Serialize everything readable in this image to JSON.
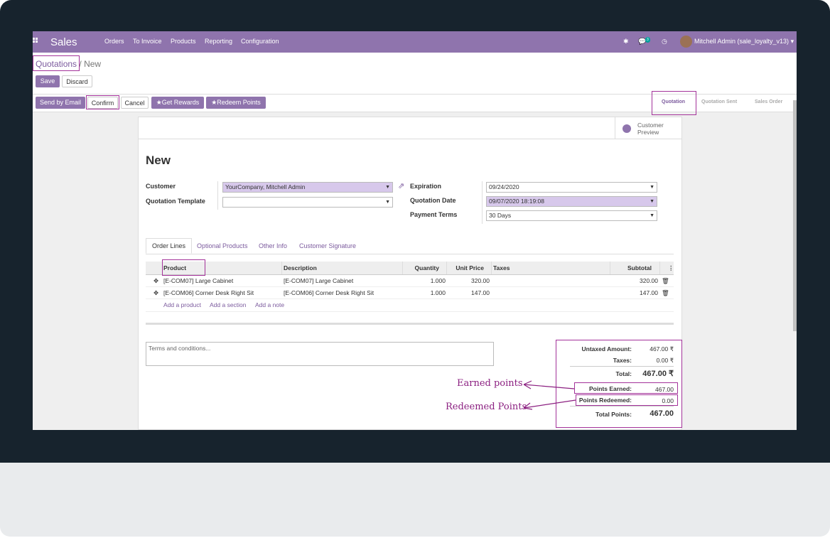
{
  "nav": {
    "brand": "Sales",
    "menus": [
      "Orders",
      "To Invoice",
      "Products",
      "Reporting",
      "Configuration"
    ],
    "chat_count": "3",
    "user": "Mitchell Admin (sale_loyalty_v13)",
    "icons": [
      "apps-icon",
      "bug-icon",
      "chat-icon",
      "clock-icon"
    ]
  },
  "breadcrumb": {
    "parent": "Quotations",
    "sep": "/",
    "current": "New"
  },
  "buttons": {
    "save": "Save",
    "discard": "Discard",
    "send_email": "Send by Email",
    "confirm": "Confirm",
    "cancel": "Cancel",
    "get_rewards": "Get Rewards",
    "redeem_points": "Redeem Points"
  },
  "stages": [
    "Quotation",
    "Quotation Sent",
    "Sales Order"
  ],
  "preview": {
    "line1": "Customer",
    "line2": "Preview"
  },
  "form": {
    "title": "New",
    "customer_label": "Customer",
    "customer_value": "YourCompany, Mitchell Admin",
    "template_label": "Quotation Template",
    "template_value": "",
    "expiration_label": "Expiration",
    "expiration_value": "09/24/2020",
    "qdate_label": "Quotation Date",
    "qdate_value": "09/07/2020 18:19:08",
    "terms_label": "Payment Terms",
    "terms_value": "30 Days"
  },
  "tabs": [
    "Order Lines",
    "Optional Products",
    "Other Info",
    "Customer Signature"
  ],
  "table": {
    "headers": [
      "Product",
      "Description",
      "Quantity",
      "Unit Price",
      "Taxes",
      "Subtotal"
    ],
    "rows": [
      {
        "product": "[E-COM07] Large Cabinet",
        "description": "[E-COM07] Large Cabinet",
        "quantity": "1.000",
        "unit_price": "320.00",
        "taxes": "",
        "subtotal": "320.00"
      },
      {
        "product": "[E-COM06] Corner Desk Right Sit",
        "description": "[E-COM06] Corner Desk Right Sit",
        "quantity": "1.000",
        "unit_price": "147.00",
        "taxes": "",
        "subtotal": "147.00"
      }
    ],
    "add_product": "Add a product",
    "add_section": "Add a section",
    "add_note": "Add a note"
  },
  "terms_placeholder": "Terms and conditions...",
  "totals": {
    "untaxed_label": "Untaxed Amount:",
    "untaxed_value": "467.00 ₹",
    "taxes_label": "Taxes:",
    "taxes_value": "0.00 ₹",
    "total_label": "Total:",
    "total_value": "467.00 ₹",
    "earned_label": "Points Earned:",
    "earned_value": "467.00",
    "redeemed_label": "Points Redeemed:",
    "redeemed_value": "0.00",
    "total_points_label": "Total Points:",
    "total_points_value": "467.00"
  },
  "annotations": {
    "earned": "Earned  points",
    "redeemed": "Redeemed  Points"
  },
  "colors": {
    "primary": "#8f74ad",
    "highlight": "#a3329a",
    "required_field": "#d7c8eb"
  }
}
